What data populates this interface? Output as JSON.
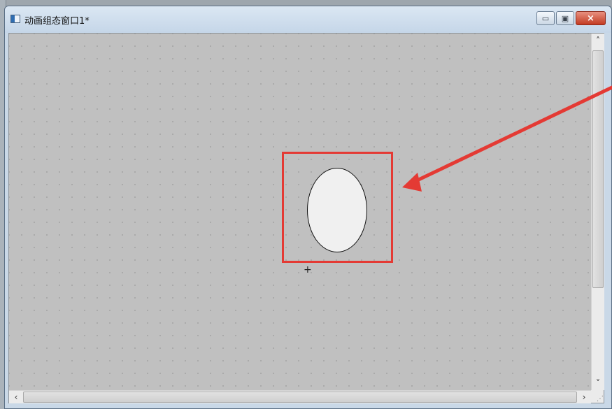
{
  "window": {
    "title": "动画组态窗口1*"
  },
  "window_controls": {
    "minimize": "▭",
    "maximize": "▣",
    "close": "×"
  },
  "scroll": {
    "up": "˄",
    "down": "˅",
    "left": "‹",
    "right": "›",
    "grip": "⋰"
  },
  "canvas": {
    "cursor": "+"
  },
  "colors": {
    "annotation": "#e43a34",
    "canvas": "#c0c0c0",
    "ellipse": "#f0f0f0"
  }
}
